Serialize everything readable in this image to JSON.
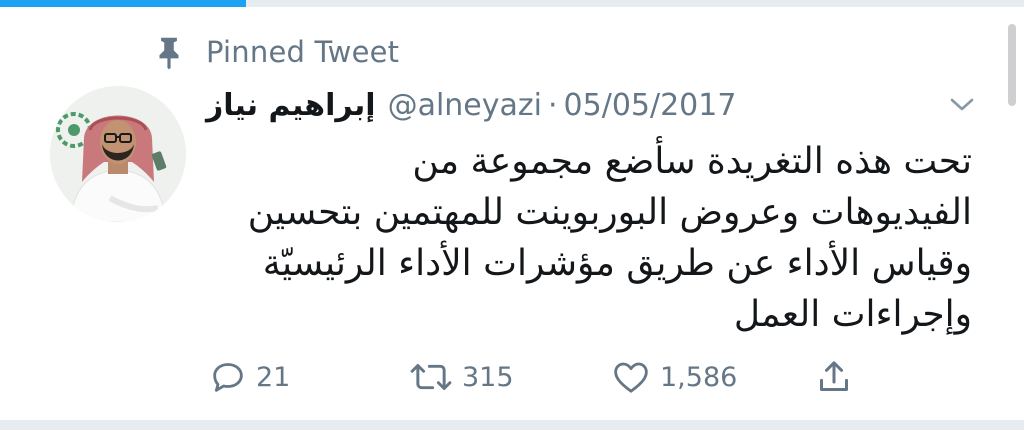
{
  "status": {
    "load_progress": 0.24
  },
  "tweet": {
    "pinned_label": "Pinned Tweet",
    "display_name": "إبراهيم نياز",
    "handle": "@alneyazi",
    "separator": "·",
    "date": "05/05/2017",
    "text_lines": [
      "تحت هذه التغريدة سأضع مجموعة من",
      "الفيديوهات وعروض البوربوينت للمهتمين بتحسين",
      "وقياس الأداء عن طريق مؤشرات الأداء الرئيسيّة",
      "وإجراءات العمل"
    ],
    "actions": {
      "replies": "21",
      "retweets": "315",
      "likes": "1,586"
    }
  },
  "icons": {
    "pin": "pin-icon",
    "reply": "reply-icon",
    "retweet": "retweet-icon",
    "like": "heart-icon",
    "share": "share-icon",
    "caret": "chevron-down-icon"
  },
  "colors": {
    "accent": "#1da1f2",
    "secondary_text": "#657786",
    "primary_text": "#14171a",
    "divider": "#e6ecf0"
  }
}
